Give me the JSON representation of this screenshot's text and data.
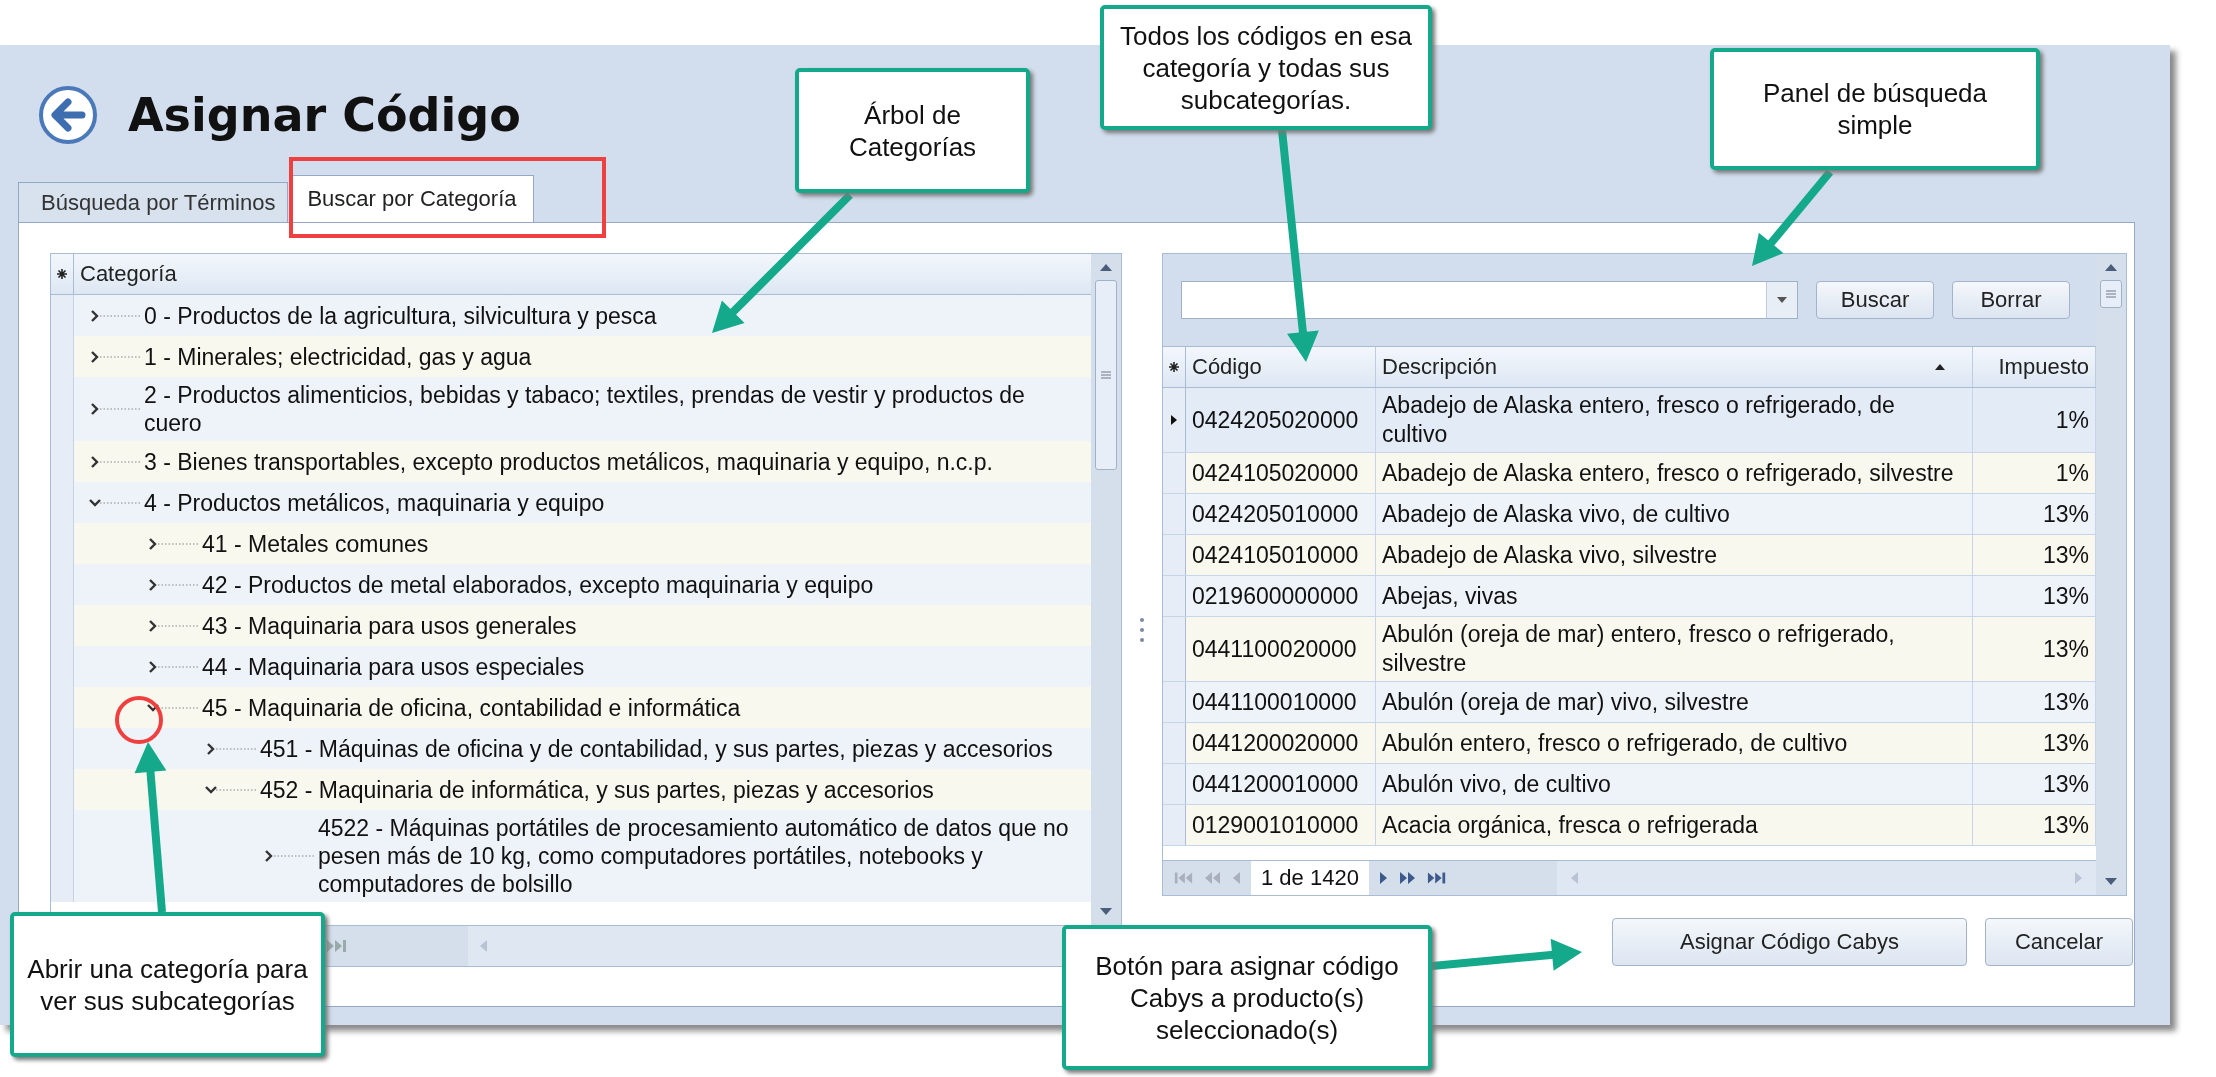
{
  "window": {
    "title": "Asignar Código"
  },
  "tabs": [
    {
      "label": "Búsqueda por Términos",
      "selected": false
    },
    {
      "label": "Buscar por Categoría",
      "selected": true
    }
  ],
  "tree": {
    "header": "Categoría",
    "nodes": [
      {
        "label": "0 - Productos de la agricultura, silvicultura y pesca",
        "expanded": false
      },
      {
        "label": "1 - Minerales; electricidad, gas y agua",
        "expanded": false
      },
      {
        "label": "2 - Productos alimenticios, bebidas y tabaco; textiles, prendas de vestir y productos de cuero",
        "expanded": false
      },
      {
        "label": "3 - Bienes transportables, excepto productos metálicos, maquinaria y equipo, n.c.p.",
        "expanded": false
      },
      {
        "label": "4 - Productos metálicos, maquinaria y equipo",
        "expanded": true,
        "children": [
          {
            "label": "41 - Metales comunes",
            "expanded": false
          },
          {
            "label": "42 - Productos de metal elaborados, excepto maquinaria y equipo",
            "expanded": false
          },
          {
            "label": "43 - Maquinaria para usos generales",
            "expanded": false
          },
          {
            "label": "44 - Maquinaria para usos especiales",
            "expanded": false
          },
          {
            "label": "45 - Maquinaria de oficina, contabilidad e informática",
            "expanded": true,
            "children": [
              {
                "label": "451 - Máquinas de oficina y de contabilidad, y sus partes, piezas y accesorios",
                "expanded": false
              },
              {
                "label": "452 - Maquinaria de informática, y sus partes, piezas y accesorios",
                "expanded": true,
                "children": [
                  {
                    "label": "4522 - Máquinas portátiles de procesamiento automático de datos que no pesen más de 10 kg, como computadores portátiles, notebooks y computadores de bolsillo",
                    "expanded": false
                  }
                ]
              }
            ]
          }
        ]
      }
    ]
  },
  "search": {
    "buttons": [
      "Buscar",
      "Borrar"
    ]
  },
  "grid": {
    "columns": [
      {
        "label": "Código",
        "sorted": false
      },
      {
        "label": "Descripción",
        "sorted": true
      },
      {
        "label": "Impuesto",
        "sorted": false
      }
    ],
    "rows": [
      {
        "cells": [
          "0424205020000",
          "Abadejo de Alaska entero, fresco o refrigerado, de cultivo",
          "1%"
        ],
        "selected": true
      },
      {
        "cells": [
          "0424105020000",
          "Abadejo de Alaska entero, fresco o refrigerado, silvestre",
          "1%"
        ],
        "selected": false
      },
      {
        "cells": [
          "0424205010000",
          "Abadejo de Alaska vivo, de cultivo",
          "13%"
        ],
        "selected": false
      },
      {
        "cells": [
          "0424105010000",
          "Abadejo de Alaska vivo, silvestre",
          "13%"
        ],
        "selected": false
      },
      {
        "cells": [
          "0219600000000",
          "Abejas, vivas",
          "13%"
        ],
        "selected": false
      },
      {
        "cells": [
          "0441100020000",
          "Abulón (oreja de mar) entero, fresco o refrigerado, silvestre",
          "13%"
        ],
        "selected": false
      },
      {
        "cells": [
          "0441100010000",
          "Abulón (oreja de mar) vivo, silvestre",
          "13%"
        ],
        "selected": false
      },
      {
        "cells": [
          "0441200020000",
          "Abulón entero, fresco o refrigerado, de cultivo",
          "13%"
        ],
        "selected": false
      },
      {
        "cells": [
          "0441200010000",
          "Abulón vivo, de cultivo",
          "13%"
        ],
        "selected": false
      },
      {
        "cells": [
          "0129001010000",
          "Acacia orgánica, fresca o refrigerada",
          "13%"
        ],
        "selected": false
      }
    ],
    "pager": "1 de 1420"
  },
  "actions": [
    "Asignar Código Cabys",
    "Cancelar"
  ],
  "callouts": [
    "Árbol de Categorías",
    "Todos los códigos en esa categoría y todas sus subcategorías.",
    "Panel de búsqueda simple",
    "Abrir una categoría para ver sus subcategorías",
    "Botón para asignar código Cabys a producto(s) seleccionado(s)"
  ]
}
